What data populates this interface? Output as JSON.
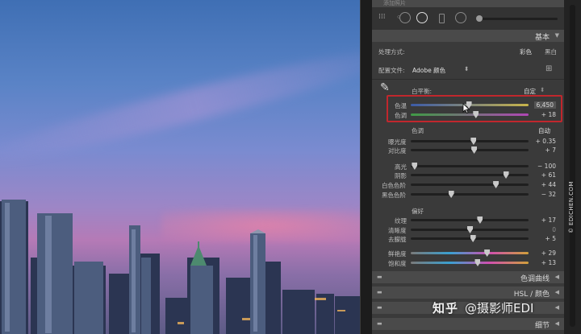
{
  "top_bar": {
    "title": "添加照片"
  },
  "basic": {
    "title": "基本",
    "treatment_label": "处理方式:",
    "treatment_color": "彩色",
    "treatment_bw": "黑白",
    "profile_label": "配置文件:",
    "profile_value": "Adobe 颜色",
    "wb_label": "白平衡:",
    "wb_value": "自定",
    "temp": {
      "label": "色温",
      "value": "6,450",
      "position": 0.49
    },
    "tint": {
      "label": "色调",
      "value": "+ 18",
      "position": 0.55
    },
    "tone_label": "色调",
    "tone_auto": "自动",
    "exposure": {
      "label": "曝光度",
      "value": "+ 0.35",
      "position": 0.53
    },
    "contrast": {
      "label": "对比度",
      "value": "+ 7",
      "position": 0.535
    },
    "highlights": {
      "label": "高光",
      "value": "− 100",
      "position": 0.0
    },
    "shadows": {
      "label": "阴影",
      "value": "+ 61",
      "position": 0.805
    },
    "whites": {
      "label": "白色色阶",
      "value": "+ 44",
      "position": 0.72
    },
    "blacks": {
      "label": "黑色色阶",
      "value": "− 32",
      "position": 0.34
    },
    "presence_label": "偏好",
    "texture": {
      "label": "纹理",
      "value": "+ 17",
      "position": 0.585
    },
    "clarity": {
      "label": "清晰度",
      "value": "0",
      "position": 0.5
    },
    "dehaze": {
      "label": "去朦胧",
      "value": "+ 5",
      "position": 0.525
    },
    "vibrance": {
      "label": "鲜艳度",
      "value": "+ 29",
      "position": 0.645
    },
    "saturation": {
      "label": "饱和度",
      "value": "+ 13",
      "position": 0.565
    }
  },
  "sections": {
    "tone_curve": "色调曲线",
    "hsl": "HSL / 颜色",
    "detail": "细节"
  },
  "sidebar_credit": "© EDICHEN.COM",
  "watermark": {
    "brand": "知乎",
    "author": "@摄影师EDI"
  }
}
